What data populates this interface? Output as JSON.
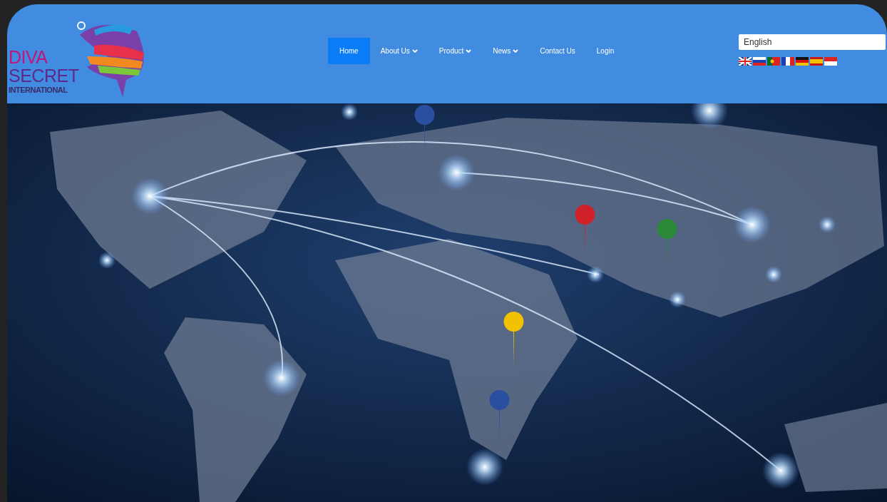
{
  "logo": {
    "lines": [
      "DIVA",
      "SECRET",
      "INTERNATIONAL"
    ]
  },
  "nav": [
    {
      "label": "Home",
      "selected": true,
      "dropdown": false
    },
    {
      "label": "About Us",
      "selected": false,
      "dropdown": true
    },
    {
      "label": "Product",
      "selected": false,
      "dropdown": true
    },
    {
      "label": "News",
      "selected": false,
      "dropdown": true
    },
    {
      "label": "Contact Us",
      "selected": false,
      "dropdown": false
    },
    {
      "label": "Login",
      "selected": false,
      "dropdown": false
    }
  ],
  "language": {
    "value": "English",
    "flags": [
      {
        "kind": "uk"
      },
      {
        "kind": "ru"
      },
      {
        "kind": "pt"
      },
      {
        "kind": "fr"
      },
      {
        "kind": "de"
      },
      {
        "kind": "es"
      },
      {
        "kind": "id"
      }
    ]
  }
}
